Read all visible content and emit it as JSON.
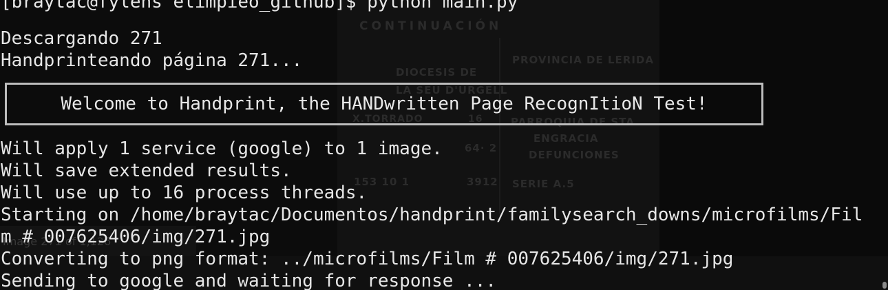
{
  "terminal": {
    "prompt_line": "[braytac@fylens elimpieo_github]$ python main.py",
    "lines": [
      "Descargando 271",
      "Handprinteando página 271...",
      "Will apply 1 service (google) to 1 image.",
      "Will save extended results.",
      "Will use up to 16 process threads.",
      "Starting on /home/braytac/Documentos/handprint/familysearch_downs/microfilms/Fil",
      "m # 007625406/img/271.jpg",
      "Converting to png format: ../microfilms/Film # 007625406/img/271.jpg",
      "Sending to google and waiting for response ..."
    ],
    "welcome_banner": "Welcome to Handprint, the HANDwritten Page RecognItioN Test!"
  },
  "background_document": {
    "title": "CONTINUACIÓN",
    "province": "PROVINCIA  DE  LERIDA",
    "diocese_line1": "DIOCESIS   DE",
    "diocese_line2": "LA SEU D'URGELL",
    "name": "X.TORRADO",
    "number_16": "16",
    "parish": "PARROQUIA  DE  STA",
    "parish_name": "ENGRACIA",
    "record_type": "DEFUNCIONES",
    "number_64": "64· 2",
    "numbers_row": "153   10   1",
    "number_3912": "3912",
    "series": "SERIE  A.5",
    "image_label": "Image 271 of 1,126"
  },
  "colors": {
    "background": "#0c0c0c",
    "text": "#e6e6e6",
    "banner_border": "#bdbdbd"
  }
}
